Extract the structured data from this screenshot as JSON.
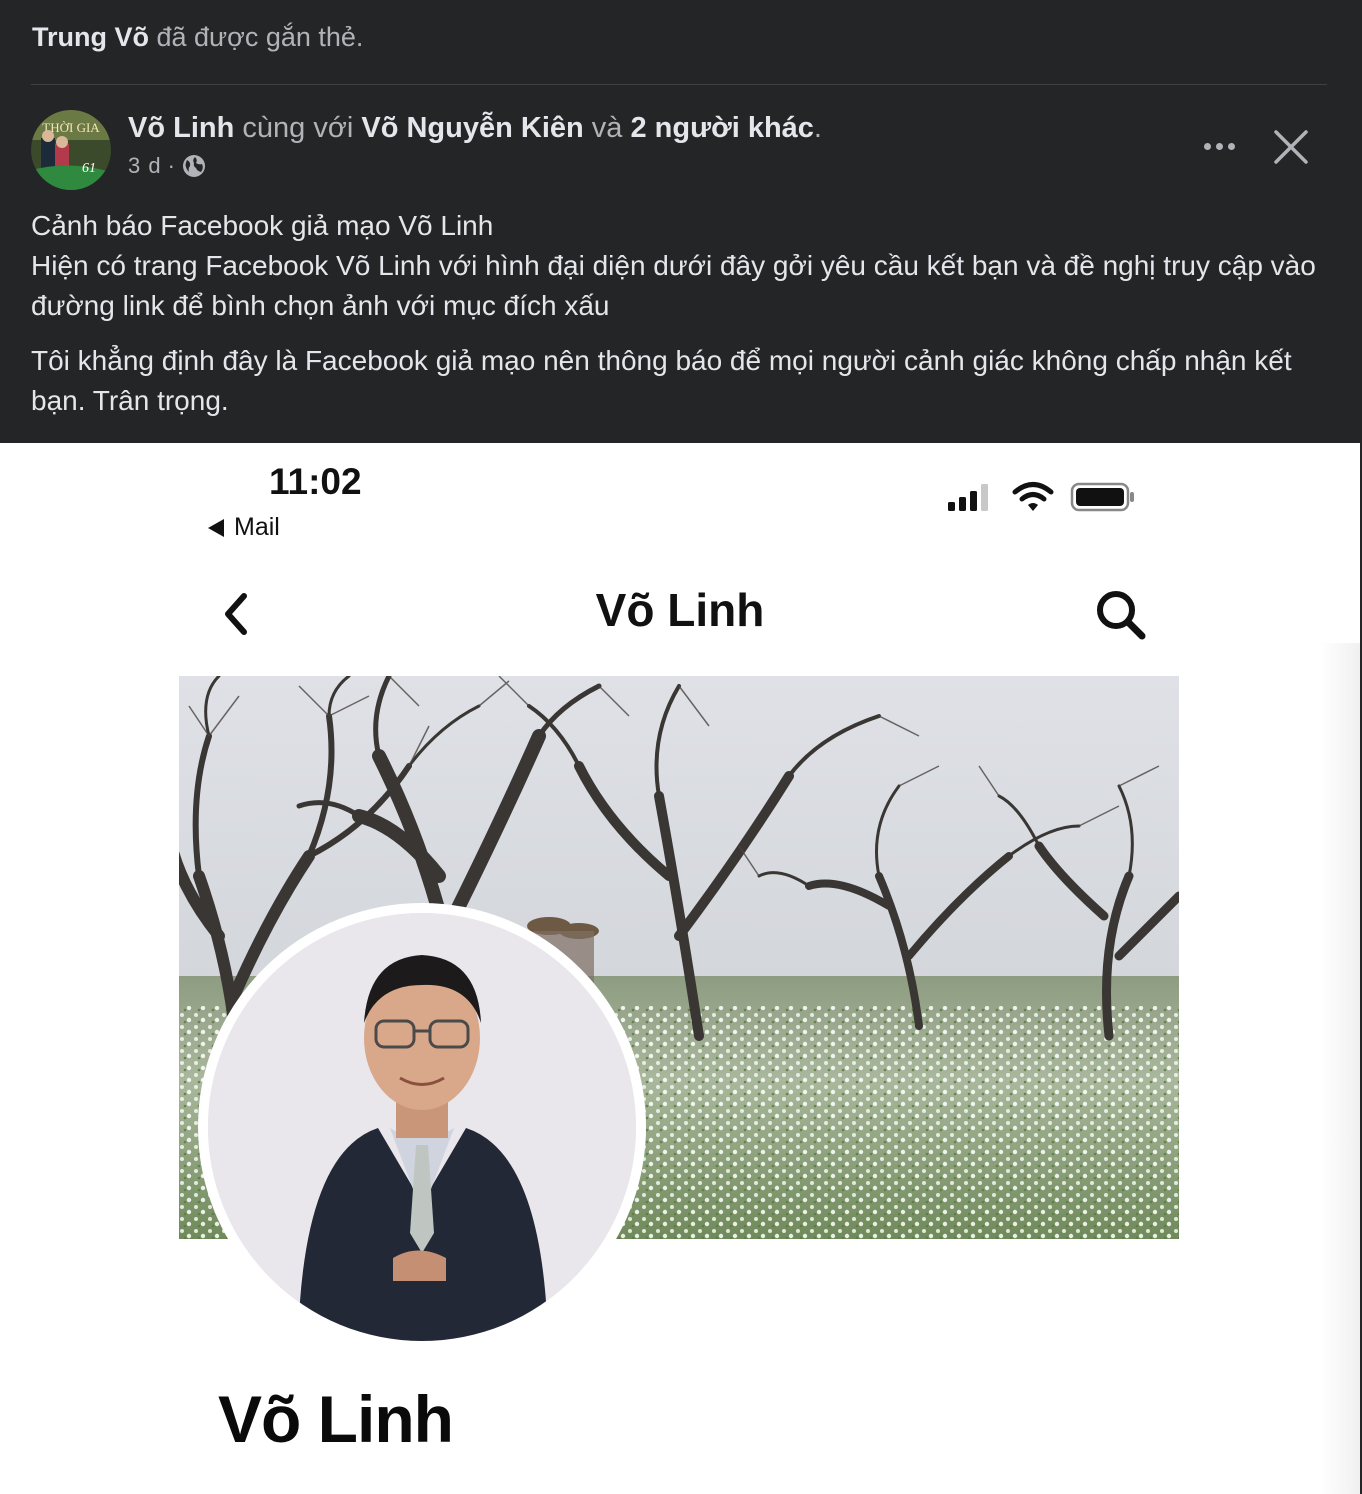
{
  "post": {
    "tag_name": "Trung Võ",
    "tag_suffix": " đã được gắn thẻ.",
    "author": "Võ Linh",
    "with_text": " cùng với ",
    "with_name": "Võ Nguyễn Kiên",
    "and_text": " và ",
    "others": "2 người khác",
    "period": ".",
    "time": "3 d",
    "dot": "·",
    "avatar_text": "THỜI GIA",
    "avatar_badge": "61",
    "lines": [
      "Cảnh báo Facebook giả mạo Võ Linh",
      "Hiện có trang Facebook Võ Linh với hình đại diện dưới đây gởi yêu cầu kết bạn và đề nghị truy cập vào đường link để bình chọn ảnh với mục đích xấu"
    ],
    "paragraph2": "Tôi khẳng định đây là Facebook giả mạo nên thông báo để mọi người cảnh giác không chấp nhận kết bạn. Trân trọng."
  },
  "icons": {
    "globe": "globe-icon",
    "more": "more-horizontal-icon",
    "close": "close-icon",
    "back": "chevron-left-icon",
    "search": "search-icon",
    "signal": "signal-icon",
    "wifi": "wifi-icon",
    "battery": "battery-icon"
  },
  "phone": {
    "time": "11:02",
    "back_app": "Mail",
    "nav_title": "Võ Linh",
    "profile_name": "Võ Linh"
  },
  "colors": {
    "dark_bg": "#242526",
    "primary_text": "#e4e6eb",
    "secondary_text": "#b0b3b8"
  }
}
